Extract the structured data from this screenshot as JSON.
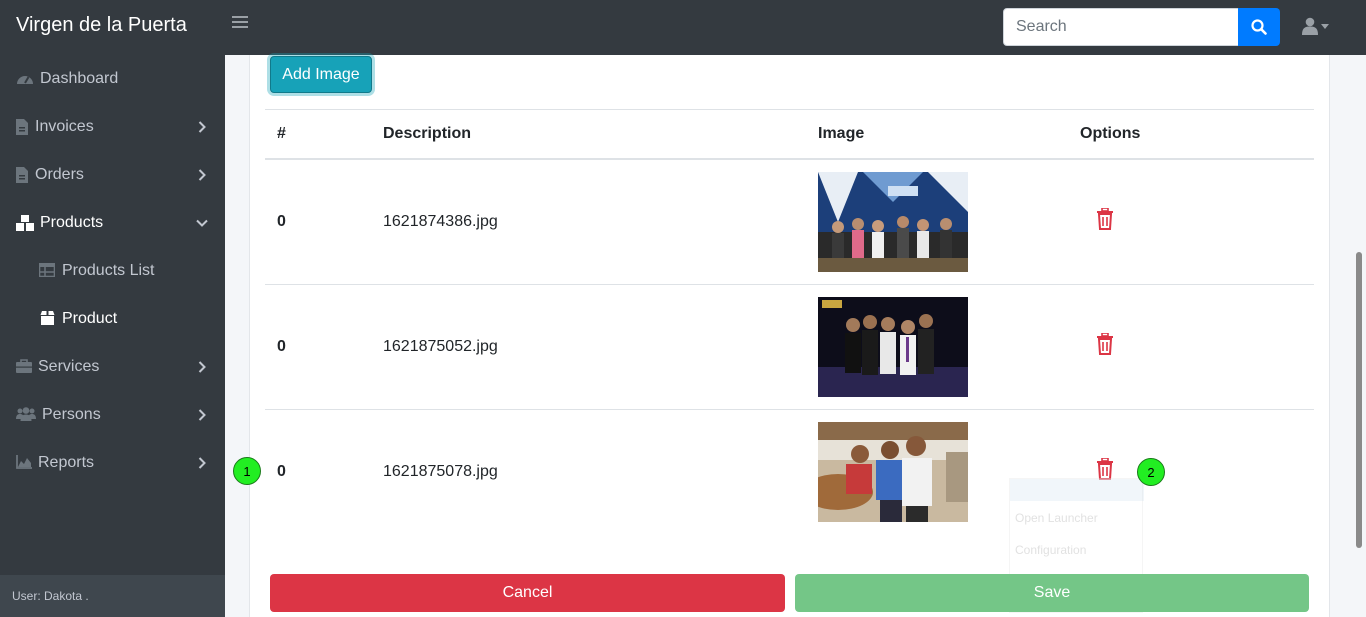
{
  "navbar": {
    "brand": "Virgen de la Puerta",
    "search_placeholder": "Search"
  },
  "sidebar": {
    "items": [
      {
        "label": "Dashboard"
      },
      {
        "label": "Invoices"
      },
      {
        "label": "Orders"
      },
      {
        "label": "Products"
      },
      {
        "label": "Products List"
      },
      {
        "label": "Product"
      },
      {
        "label": "Services"
      },
      {
        "label": "Persons"
      },
      {
        "label": "Reports"
      }
    ],
    "footer": "User: Dakota ."
  },
  "main": {
    "add_button": "Add Image",
    "table": {
      "headers": [
        "#",
        "Description",
        "Image",
        "Options"
      ],
      "rows": [
        {
          "num": "0",
          "description": "1621874386.jpg"
        },
        {
          "num": "0",
          "description": "1621875052.jpg"
        },
        {
          "num": "0",
          "description": "1621875078.jpg"
        }
      ]
    },
    "cancel_button": "Cancel",
    "save_button": "Save"
  },
  "markers": [
    "1",
    "2"
  ],
  "ghost_menu": [
    "Open Launcher",
    "Configuration"
  ],
  "colors": {
    "navbar": "#343a40",
    "accent": "#007bff",
    "info": "#17a2b8",
    "danger": "#dc3545",
    "success_faded": "#74c687",
    "trash_icon": "#dc3545"
  }
}
